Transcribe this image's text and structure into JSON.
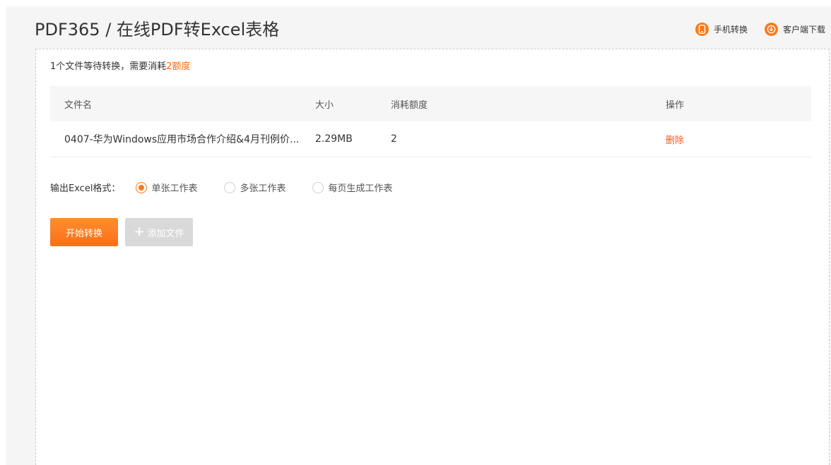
{
  "header": {
    "title": "PDF365 / 在线PDF转Excel表格",
    "links": [
      {
        "label": "手机转换",
        "icon": "phone-icon"
      },
      {
        "label": "客户端下载",
        "icon": "download-icon"
      }
    ]
  },
  "info": {
    "prefix": "1个文件等待转换，需要消耗",
    "cost": "2额度"
  },
  "table": {
    "headers": {
      "name": "文件名",
      "size": "大小",
      "cost": "消耗额度",
      "op": "操作"
    },
    "rows": [
      {
        "name": "0407-华为Windows应用市场合作介绍&4月刊例价...",
        "size": "2.29MB",
        "cost": "2",
        "op": "删除"
      }
    ]
  },
  "format": {
    "label": "输出Excel格式：",
    "options": [
      {
        "label": "单张工作表",
        "checked": true
      },
      {
        "label": "多张工作表",
        "checked": false
      },
      {
        "label": "每页生成工作表",
        "checked": false
      }
    ]
  },
  "buttons": {
    "start": "开始转换",
    "add": "添加文件"
  },
  "colors": {
    "accent": "#ff7a1a",
    "delete": "#ff5a1f",
    "disabled": "#d9d9d9"
  }
}
